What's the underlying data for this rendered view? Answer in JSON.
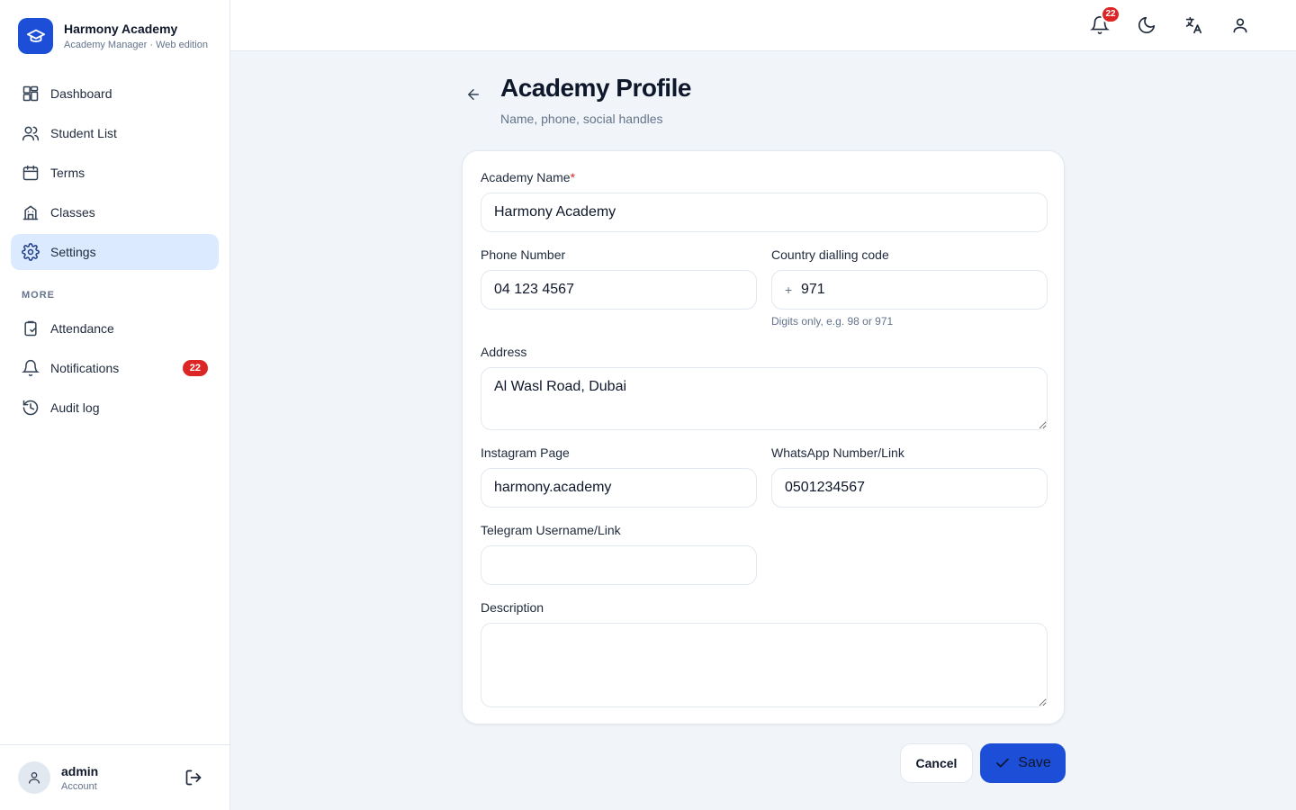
{
  "brand": {
    "name": "Harmony Academy",
    "subtitle": "Academy Manager · Web edition"
  },
  "nav": {
    "items": [
      {
        "label": "Dashboard",
        "icon": "dashboard-icon"
      },
      {
        "label": "Student List",
        "icon": "users-icon"
      },
      {
        "label": "Terms",
        "icon": "calendar-icon"
      },
      {
        "label": "Classes",
        "icon": "building-icon"
      },
      {
        "label": "Settings",
        "icon": "gear-icon",
        "active": true
      }
    ],
    "more_label": "MORE",
    "more_items": [
      {
        "label": "Attendance",
        "icon": "clipboard-icon"
      },
      {
        "label": "Notifications",
        "icon": "bell-icon",
        "badge": "22"
      },
      {
        "label": "Audit log",
        "icon": "history-icon"
      }
    ]
  },
  "account": {
    "name": "admin",
    "role": "Account"
  },
  "topbar": {
    "notification_count": "22"
  },
  "header": {
    "title": "Academy Profile",
    "subtitle": "Name, phone, social handles"
  },
  "form": {
    "academy_name": {
      "label": "Academy Name",
      "required_mark": "*",
      "value": "Harmony Academy"
    },
    "phone": {
      "label": "Phone Number",
      "value": "04 123 4567"
    },
    "country_code": {
      "label": "Country dialling code",
      "prefix": "+",
      "value": "971",
      "hint": "Digits only, e.g. 98 or 971"
    },
    "address": {
      "label": "Address",
      "value": "Al Wasl Road, Dubai"
    },
    "instagram": {
      "label": "Instagram Page",
      "value": "harmony.academy"
    },
    "whatsapp": {
      "label": "WhatsApp Number/Link",
      "value": "0501234567"
    },
    "telegram": {
      "label": "Telegram Username/Link",
      "value": ""
    },
    "description": {
      "label": "Description",
      "value": ""
    }
  },
  "actions": {
    "cancel_label": "Cancel",
    "save_label": "Save"
  },
  "colors": {
    "primary": "#1d4ed8",
    "active_nav_bg": "#dbeafe",
    "badge": "#dc2626",
    "page_bg": "#f1f5f9"
  }
}
